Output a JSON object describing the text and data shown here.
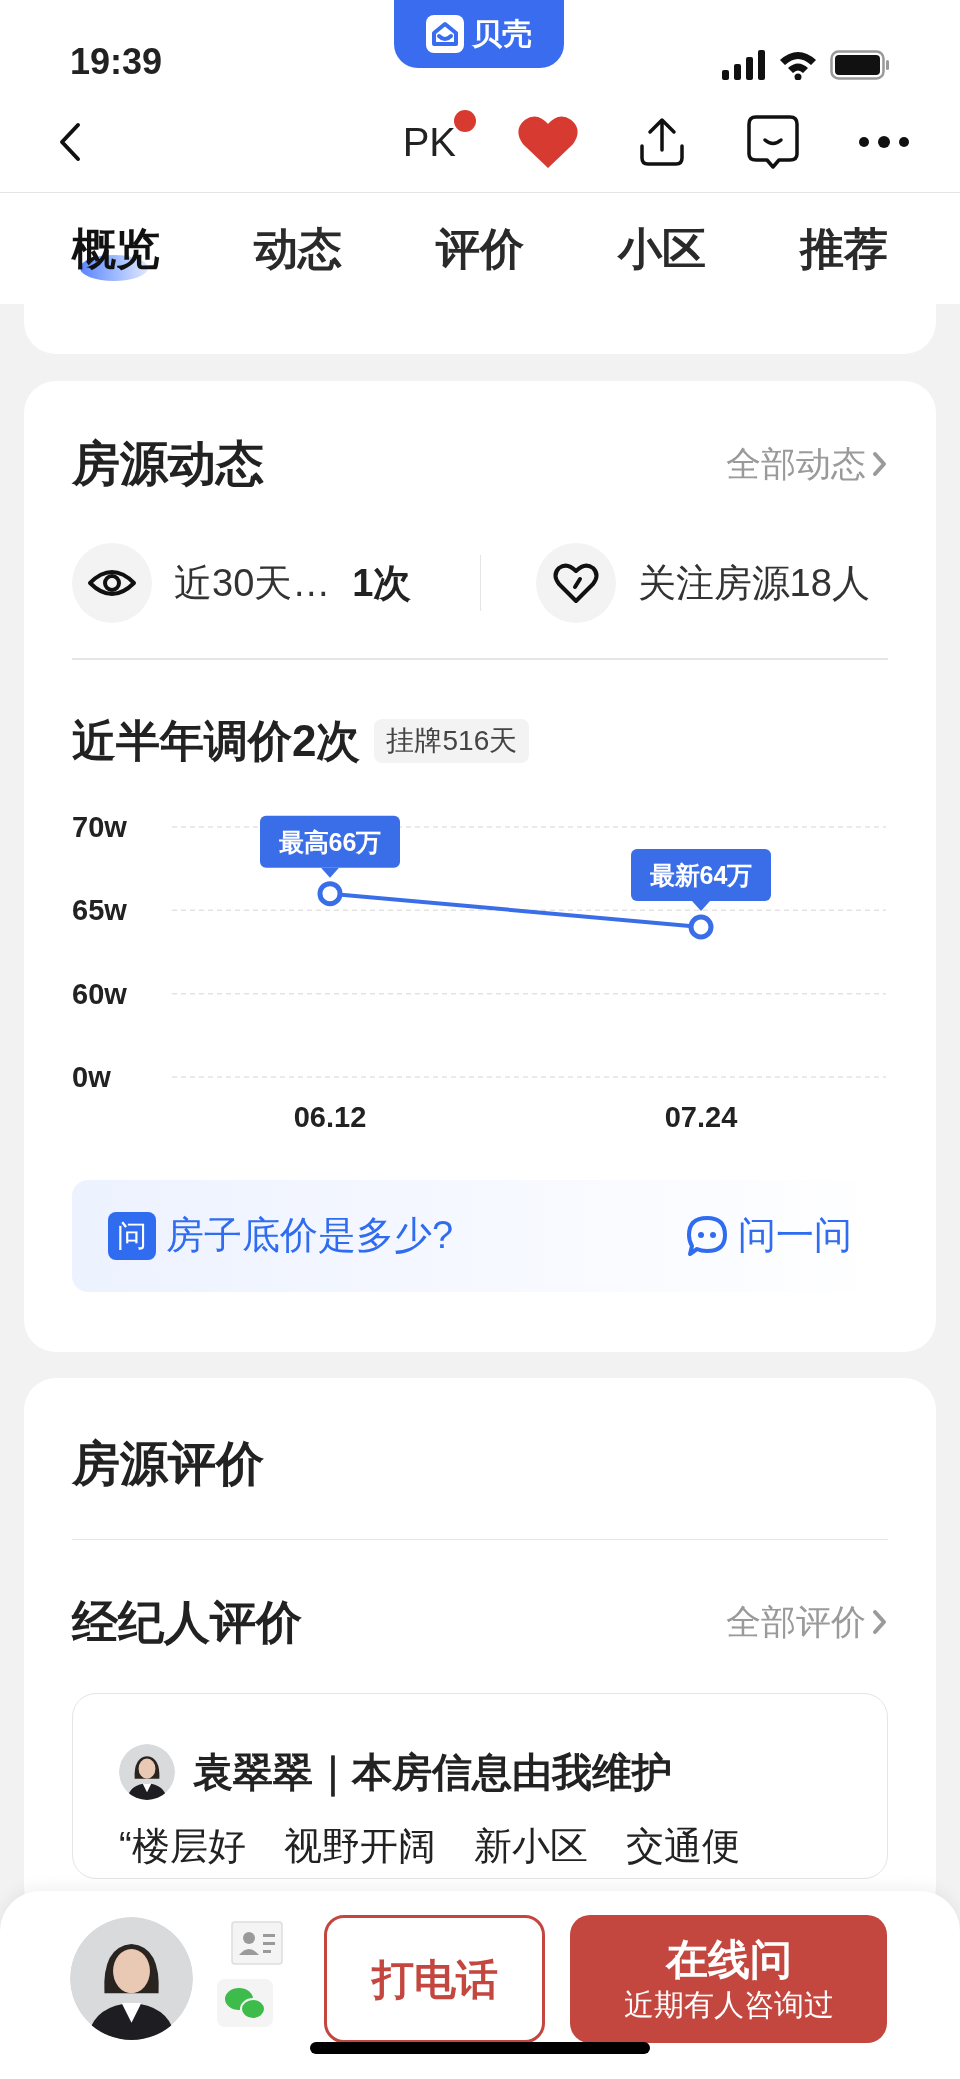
{
  "status_bar": {
    "time": "19:39"
  },
  "app_badge": {
    "name": "贝壳"
  },
  "nav": {
    "pk_label": "PK",
    "pk_dot": true,
    "favorited": true
  },
  "tabs": [
    {
      "label": "概览",
      "selected": true
    },
    {
      "label": "动态",
      "selected": false
    },
    {
      "label": "评价",
      "selected": false
    },
    {
      "label": "小区",
      "selected": false
    },
    {
      "label": "推荐",
      "selected": false
    }
  ],
  "listing_activity": {
    "title": "房源动态",
    "more_link": "全部动态",
    "stats": [
      {
        "kind": "views",
        "text": "近30天…",
        "value": "1次"
      },
      {
        "kind": "follows",
        "text": "关注房源18人"
      }
    ],
    "price_history": {
      "title": "近半年调价2次",
      "listed_badge": "挂牌516天",
      "chart_data": {
        "type": "line",
        "categories": [
          "06.12",
          "07.24"
        ],
        "series": [
          {
            "color": "#3a6ee8",
            "marker": "circle",
            "values": [
              66,
              64
            ]
          }
        ],
        "ylim": [
          55,
          70
        ],
        "yticks": [
          {
            "value": 70,
            "label": "70w"
          },
          {
            "value": 65,
            "label": "65w"
          },
          {
            "value": 60,
            "label": "60w"
          }
        ],
        "annotations": [
          {
            "x": "06.12",
            "y": 66,
            "text": "最高66万"
          },
          {
            "x": "07.24",
            "y": 64,
            "text": "最新64万"
          }
        ]
      },
      "axis_floor_label": "0w"
    },
    "ask_bar": {
      "badge": "问",
      "question": "房子底价是多少?",
      "action": "问一问"
    }
  },
  "evaluation": {
    "title": "房源评价",
    "agent_section": {
      "title": "经纪人评价",
      "more_link": "全部评价",
      "review": {
        "agent_line": "袁翠翠｜本房信息由我维护",
        "quote": "“楼层好　视野开阔　新小区　交通便"
      }
    }
  },
  "bottom_bar": {
    "call_button": "打电话",
    "chat_button": {
      "label": "在线问",
      "subtitle": "近期有人咨询过"
    }
  }
}
